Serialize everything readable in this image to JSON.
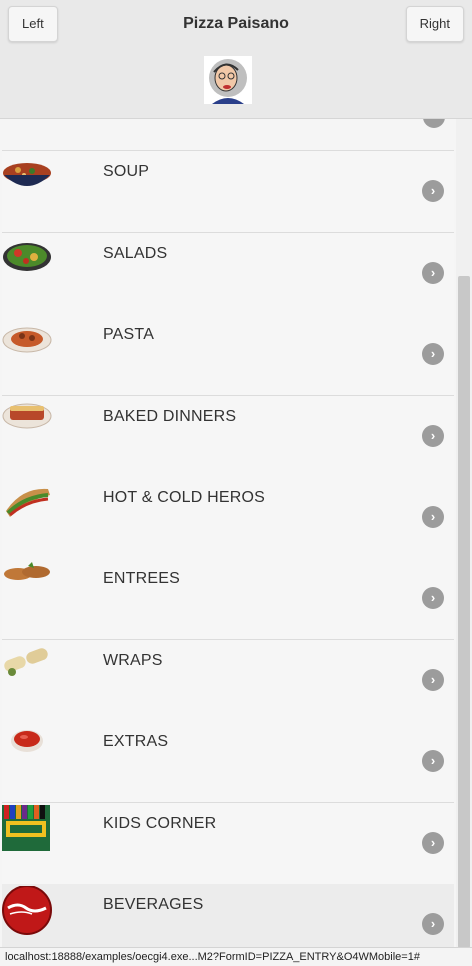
{
  "header": {
    "title": "Pizza Paisano",
    "left_button": "Left",
    "right_button": "Right"
  },
  "menu": {
    "items": [
      {
        "label": "SOUP",
        "icon": "soup-bowl-icon"
      },
      {
        "label": "SALADS",
        "icon": "salad-plate-icon"
      },
      {
        "label": "PASTA",
        "icon": "pasta-plate-icon"
      },
      {
        "label": "BAKED DINNERS",
        "icon": "baked-dinner-icon"
      },
      {
        "label": "HOT & COLD HEROS",
        "icon": "hero-sandwich-icon"
      },
      {
        "label": "ENTREES",
        "icon": "entree-cutlets-icon"
      },
      {
        "label": "WRAPS",
        "icon": "wraps-icon"
      },
      {
        "label": "EXTRAS",
        "icon": "sauce-cup-icon"
      },
      {
        "label": "KIDS CORNER",
        "icon": "crayons-icon"
      },
      {
        "label": "BEVERAGES",
        "icon": "coca-cola-icon"
      }
    ]
  },
  "status_bar": {
    "url": "localhost:18888/examples/oecgi4.exe...M2?FormID=PIZZA_ENTRY&O4WMobile=1#"
  },
  "colors": {
    "header_bg": "#e9e9e9",
    "list_bg": "#f6f6f6",
    "chevron": "#9c9c9c"
  }
}
